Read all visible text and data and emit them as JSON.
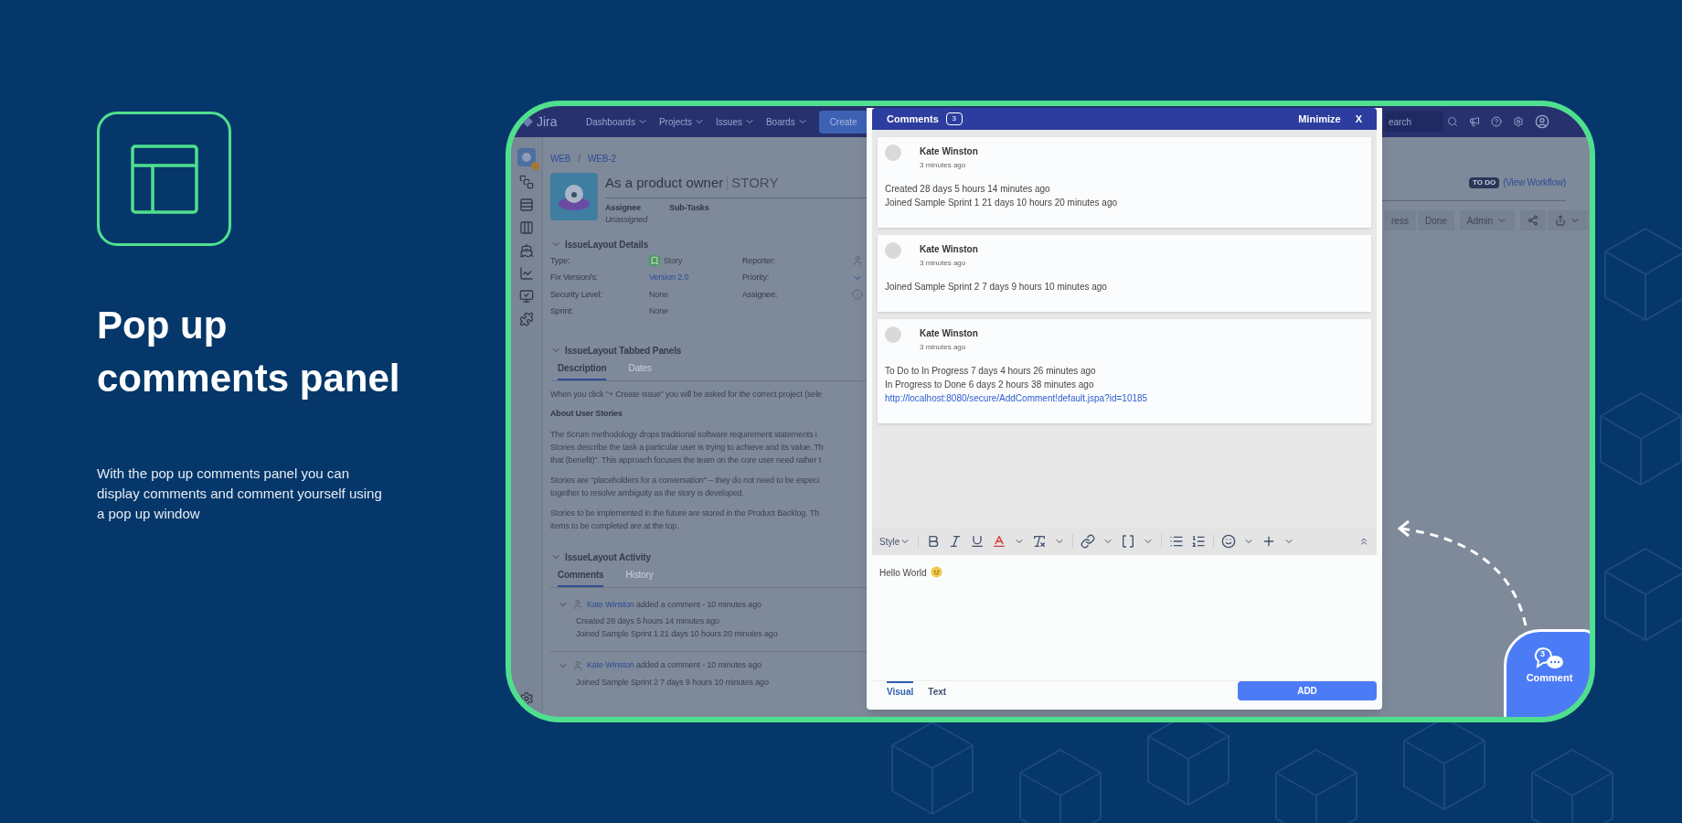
{
  "intro": {
    "title_lines": [
      "Pop up",
      "comments panel"
    ],
    "description": "With the pop up comments panel you can display comments and comment yourself using a pop up window"
  },
  "jira": {
    "nav": {
      "logo": "Jira",
      "menus": [
        "Dashboards",
        "Projects",
        "Issues",
        "Boards"
      ],
      "create": "Create",
      "search_placeholder": "earch"
    },
    "breadcrumb": {
      "project": "WEB",
      "separator": "/",
      "issue": "WEB-2"
    },
    "issue": {
      "title": "As a product owner",
      "type": "STORY",
      "assignee_label": "Assignee",
      "assignee": "Unassigned",
      "subtasks_label": "Sub-Tasks"
    },
    "status": {
      "badge": "TO DO",
      "link": "(View Workflow)"
    },
    "actions": [
      {
        "kind": "text",
        "label": "ress"
      },
      {
        "kind": "text",
        "label": "Done"
      },
      {
        "kind": "menu",
        "label": "Admin"
      },
      {
        "kind": "share"
      },
      {
        "kind": "export"
      }
    ],
    "details": {
      "heading": "IssueLayout Details",
      "expanded": true,
      "fields": [
        {
          "label": "Type:",
          "value": "Story",
          "kind": "type"
        },
        {
          "label": "Fix Version/s:",
          "value": "Version 2.0",
          "kind": "link"
        },
        {
          "label": "Security Level:",
          "value": "None",
          "kind": "plain"
        },
        {
          "label": "Sprint:",
          "value": "None",
          "kind": "plain"
        }
      ],
      "people": [
        {
          "label": "Reporter:",
          "kind": "user"
        },
        {
          "label": "Priority:",
          "kind": "priority"
        },
        {
          "label": "Assignee:",
          "kind": "unassigned"
        }
      ]
    },
    "tabbed_panels": {
      "heading": "IssueLayout Tabbed Panels",
      "expanded": true,
      "tabs": [
        {
          "label": "Description",
          "selected": true
        },
        {
          "label": "Dates",
          "selected": false
        }
      ],
      "intro": "When you click \"+ Create Issue\" you will be asked for the correct project (sele",
      "subheading": "About User Stories",
      "paragraphs": [
        [
          "The Scrum methodology drops traditional software requirement statements i",
          "Stories describe the task a particular user is trying to achieve and its value. Th",
          "that (benefit)\". This approach focuses the team on the core user need rather t"
        ],
        [
          "Stories are \"placeholders for a conversation\" – they do not need to be especi",
          "together to resolve ambiguity as the story is developed."
        ],
        [
          "Stories to be implemented in the future are stored in the Product Backlog. Th",
          "items to be completed are at the top."
        ]
      ]
    },
    "activity": {
      "heading": "IssueLayout Activity",
      "expanded": true,
      "tabs": [
        {
          "label": "Comments",
          "selected": true
        },
        {
          "label": "History",
          "selected": false
        }
      ],
      "comments": [
        {
          "author": "Kate Winston",
          "action": "added a comment - 10 minutes ago",
          "expanded": true,
          "lines": [
            "Created 28 days 5 hours 14 minutes ago",
            "Joined Sample Sprint 1 21 days 10 hours 20 minutes ago"
          ]
        },
        {
          "author": "Kate Winston",
          "action": "added a comment - 10 minutes ago",
          "expanded": true,
          "lines": [
            "Joined Sample Sprint 2 7 days 9 hours 10 minutes ago"
          ]
        }
      ]
    }
  },
  "popup": {
    "title": "Comments",
    "count": "3",
    "minimize": "Minimize",
    "close": "X",
    "comments": [
      {
        "author": "Kate Winston",
        "time": "3 minutes ago",
        "lines": [
          "Created 28 days 5 hours 14 minutes ago",
          "Joined Sample Sprint 1 21 days 10 hours 20 minutes ago"
        ]
      },
      {
        "author": "Kate Winston",
        "time": "3 minutes ago",
        "lines": [
          "Joined Sample Sprint 2 7 days 9 hours 10 minutes ago"
        ]
      },
      {
        "author": "Kate Winston",
        "time": "3 minutes ago",
        "lines": [
          "To Do to In Progress 7 days 4 hours 26 minutes ago",
          "In Progress to Done 6 days 2 hours 38 minutes ago"
        ],
        "link": "http://localhost:8080/secure/AddComment!default.jspa?id=10185"
      }
    ],
    "style_label": "Style",
    "editor_value": "Hello World",
    "modes": [
      {
        "label": "Visual",
        "selected": true
      },
      {
        "label": "Text",
        "selected": false
      }
    ],
    "submit": "ADD"
  },
  "fab": {
    "count": "3",
    "label": "Comment"
  }
}
